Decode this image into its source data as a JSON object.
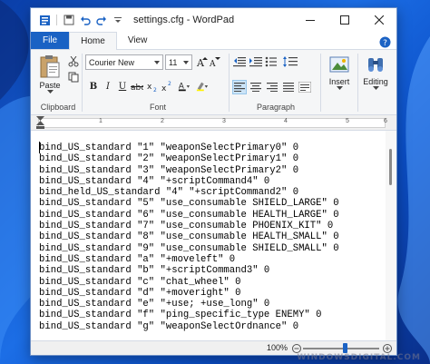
{
  "window": {
    "title": "settings.cfg - WordPad",
    "accent": "#1a62c4"
  },
  "tabs": [
    {
      "label": "File"
    },
    {
      "label": "Home"
    },
    {
      "label": "View"
    }
  ],
  "ribbon": {
    "clipboard": {
      "paste_label": "Paste",
      "group_label": "Clipboard"
    },
    "font": {
      "family": "Courier New",
      "size": "11",
      "group_label": "Font"
    },
    "paragraph": {
      "group_label": "Paragraph"
    },
    "insert": {
      "label": "Insert"
    },
    "editing": {
      "label": "Editing"
    }
  },
  "ruler": {
    "numbers": [
      "1",
      "2",
      "3",
      "4",
      "5",
      "6"
    ]
  },
  "document": {
    "lines": [
      "bind_US_standard \"1\" \"weaponSelectPrimary0\" 0",
      "bind_US_standard \"2\" \"weaponSelectPrimary1\" 0",
      "bind_US_standard \"3\" \"weaponSelectPrimary2\" 0",
      "bind_US_standard \"4\" \"+scriptCommand4\" 0",
      "bind_held_US_standard \"4\" \"+scriptCommand2\" 0",
      "bind_US_standard \"5\" \"use_consumable SHIELD_LARGE\" 0",
      "bind_US_standard \"6\" \"use_consumable HEALTH_LARGE\" 0",
      "bind_US_standard \"7\" \"use_consumable PHOENIX_KIT\" 0",
      "bind_US_standard \"8\" \"use_consumable HEALTH_SMALL\" 0",
      "bind_US_standard \"9\" \"use_consumable SHIELD_SMALL\" 0",
      "bind_US_standard \"a\" \"+moveleft\" 0",
      "bind_US_standard \"b\" \"+scriptCommand3\" 0",
      "bind_US_standard \"c\" \"chat_wheel\" 0",
      "bind_US_standard \"d\" \"+moveright\" 0",
      "bind_US_standard \"e\" \"+use; +use_long\" 0",
      "bind_US_standard \"f\" \"ping_specific_type ENEMY\" 0",
      "bind_US_standard \"g\" \"weaponSelectOrdnance\" 0"
    ]
  },
  "status": {
    "zoom": "100%",
    "zoom_level_fraction": 0.55
  },
  "watermark": "WINDOWSDIGITAL.COM"
}
